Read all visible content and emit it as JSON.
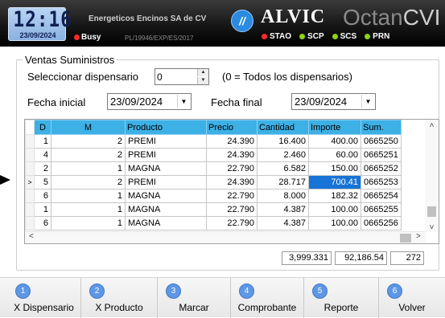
{
  "header": {
    "clock_time": "12:16",
    "clock_date": "23/09/2024",
    "company": "Energeticos Encinos SA de CV",
    "busy": "Busy",
    "permit": "PL/19946/EXP/ES/2017",
    "brand_icon": "//",
    "brand": "ALVIC",
    "product_a": "Octan",
    "product_b": "CVI",
    "status": [
      {
        "label": "STAO",
        "color": "#ff2b2b"
      },
      {
        "label": "SCP",
        "color": "#8fd316"
      },
      {
        "label": "SCS",
        "color": "#8fd316"
      },
      {
        "label": "PRN",
        "color": "#8fd316"
      }
    ]
  },
  "form": {
    "group_title": "Ventas Suministros",
    "dispensario_label": "Seleccionar dispensario",
    "dispensario_value": "0",
    "dispensario_hint": "(0 = Todos los dispensarios)",
    "fecha_inicial_label": "Fecha inicial",
    "fecha_inicial_value": "23/09/2024",
    "fecha_final_label": "Fecha final",
    "fecha_final_value": "23/09/2024"
  },
  "grid": {
    "columns": [
      "D",
      "M",
      "Producto",
      "Precio",
      "Cantidad",
      "Importe",
      "Sum."
    ],
    "rows": [
      [
        "1",
        "2",
        "PREMI",
        "24.390",
        "16.400",
        "400.00",
        "0665250"
      ],
      [
        "4",
        "2",
        "PREMI",
        "24.390",
        "2.460",
        "60.00",
        "0665251"
      ],
      [
        "2",
        "1",
        "MAGNA",
        "22.790",
        "6.582",
        "150.00",
        "0665252"
      ],
      [
        "5",
        "2",
        "PREMI",
        "24.390",
        "28.717",
        "700.41",
        "0665253"
      ],
      [
        "6",
        "1",
        "MAGNA",
        "22.790",
        "8.000",
        "182.32",
        "0665254"
      ],
      [
        "1",
        "1",
        "MAGNA",
        "22.790",
        "4.387",
        "100.00",
        "0665255"
      ],
      [
        "6",
        "1",
        "MAGNA",
        "22.790",
        "4.387",
        "100.00",
        "0665256"
      ]
    ],
    "current_row_marker": ">"
  },
  "totals": {
    "cantidad": "3,999.331",
    "importe": "92,186.54",
    "count": "272"
  },
  "buttons": [
    {
      "num": "1",
      "label": "X Dispensario"
    },
    {
      "num": "2",
      "label": "X Producto"
    },
    {
      "num": "3",
      "label": "Marcar"
    },
    {
      "num": "4",
      "label": "Comprobante"
    },
    {
      "num": "5",
      "label": "Reporte"
    },
    {
      "num": "6",
      "label": "Volver"
    }
  ]
}
